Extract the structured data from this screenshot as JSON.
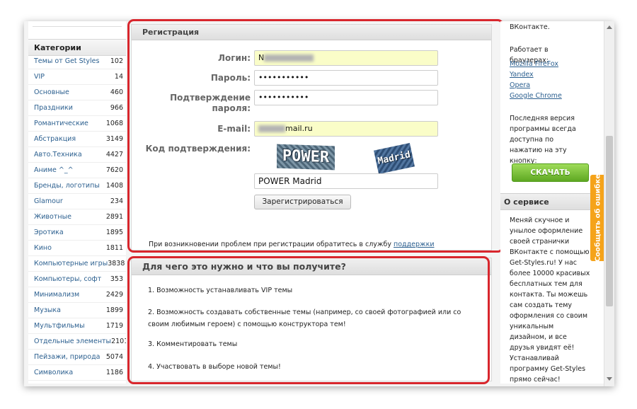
{
  "sidebar": {
    "title": "Категории",
    "categories": [
      {
        "label": "Темы от Get Styles",
        "count": "102"
      },
      {
        "label": "VIP",
        "count": "14"
      },
      {
        "label": "Основные",
        "count": "460"
      },
      {
        "label": "Праздники",
        "count": "966"
      },
      {
        "label": "Романтические",
        "count": "1068"
      },
      {
        "label": "Абстракция",
        "count": "3149"
      },
      {
        "label": "Авто.Техника",
        "count": "4427"
      },
      {
        "label": "Аниме ^_^",
        "count": "7620"
      },
      {
        "label": "Бренды, логотипы",
        "count": "1408"
      },
      {
        "label": "Glamour",
        "count": "234"
      },
      {
        "label": "Животные",
        "count": "2891"
      },
      {
        "label": "Эротика",
        "count": "1895"
      },
      {
        "label": "Кино",
        "count": "1811"
      },
      {
        "label": "Компьютерные игры",
        "count": "3838"
      },
      {
        "label": "Компьютеры, софт",
        "count": "353"
      },
      {
        "label": "Минимализм",
        "count": "2429"
      },
      {
        "label": "Музыка",
        "count": "1899"
      },
      {
        "label": "Мультфильмы",
        "count": "1719"
      },
      {
        "label": "Отдельные элементы",
        "count": "2101"
      },
      {
        "label": "Пейзажи, природа",
        "count": "5074"
      },
      {
        "label": "Символика",
        "count": "1186"
      }
    ]
  },
  "registration": {
    "title": "Регистрация",
    "login_label": "Логин:",
    "login_value_prefix": "N",
    "password_label": "Пароль:",
    "password_value": "•••••••••••",
    "confirm_label_1": "Подтверждение",
    "confirm_label_2": "пароля:",
    "confirm_value": "•••••••••••",
    "email_label": "E-mail:",
    "email_value_suffix": "mail.ru",
    "code_label": "Код подтверждения:",
    "captcha_word_1": "POWER",
    "captcha_word_2": "Madrid",
    "captcha_value": "POWER Madrid",
    "submit_label": "Зарегистрироваться",
    "note_text": "При возникновении проблем при регистрации обратитесь в службу",
    "note_link": "поддержки"
  },
  "benefits": {
    "title": "Для чего это нужно и что вы получите?",
    "items": [
      "1. Возможность устанавливать VIP темы",
      "2. Возможность создавать собственные темы (например, со своей фотографией или со своим любимым героем) с помощью конструктора тем!",
      "3. Комментировать темы",
      "4. Участвовать в выборе новой темы!"
    ]
  },
  "right": {
    "top_text": "ВКонтакте.",
    "browsers_intro": "Работает в браузерах:",
    "browsers": [
      "Mozilla FireFox",
      "Yandex",
      "Opera",
      "Google Chrome"
    ],
    "version_text": "Последняя версия программы всегда доступна по нажатию на эту кнопку:",
    "download_label": "СКАЧАТЬ",
    "service_title": "О сервисе",
    "service_text": "Меняй скучное и унылое оформление своей странички ВКонтакте с помощью Get-Styles.ru! У нас более 10000 красивых бесплатных тем для контакта. Ты можешь сам создать тему оформления со своим уникальным дизайном, и все друзья увидят её! Устанавливай программу Get-Styles прямо сейчас!"
  },
  "feedback_tab": "Сообщить об ошибке",
  "colors": {
    "highlight": "#d8262d",
    "link": "#2b5f8f",
    "download_button": "#6db52b",
    "feedback_tab": "#f5a31a",
    "autofill_yellow": "#fafdc8"
  }
}
